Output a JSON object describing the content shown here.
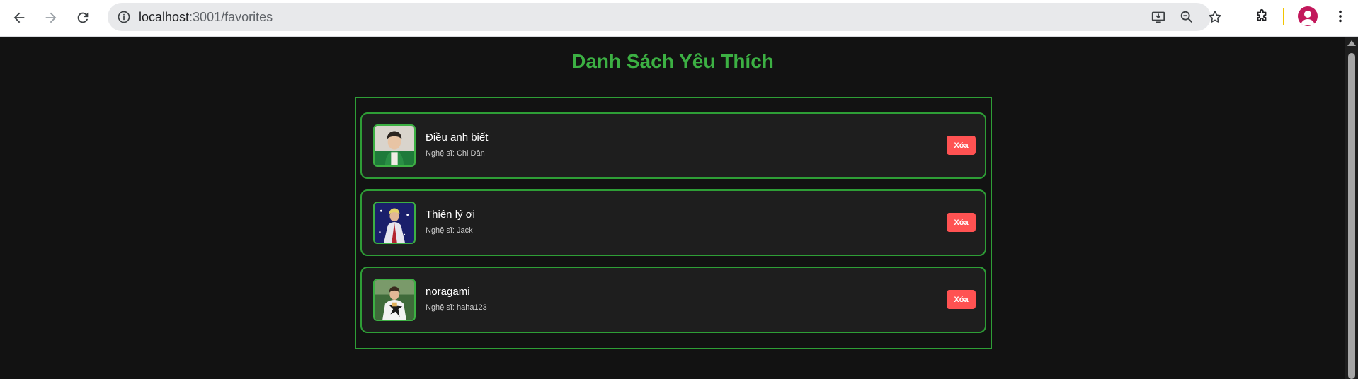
{
  "browser": {
    "url_host": "localhost",
    "url_rest": ":3001/favorites",
    "icons": {
      "back": "arrow-left-icon",
      "forward": "arrow-right-icon",
      "reload": "reload-icon",
      "info": "info-icon",
      "install": "install-app-icon",
      "zoom": "zoom-out-icon",
      "bookmark": "star-icon",
      "extensions": "puzzle-icon",
      "profile": "profile-avatar-icon",
      "menu": "kebab-menu-icon"
    }
  },
  "page": {
    "title": "Danh Sách Yêu Thích",
    "colors": {
      "accent": "#3cb043",
      "border": "#2e9e36",
      "delete": "#ff5252",
      "background": "#121212",
      "card": "#1e1e1e"
    }
  },
  "favorites": [
    {
      "title": "Điều anh biết",
      "artist_prefix": "Nghệ sĩ:",
      "artist": "Chi Dân",
      "delete_label": "Xóa"
    },
    {
      "title": "Thiên lý ơi",
      "artist_prefix": "Nghệ sĩ:",
      "artist": "Jack",
      "delete_label": "Xóa"
    },
    {
      "title": "noragami",
      "artist_prefix": "Nghệ sĩ:",
      "artist": "haha123",
      "delete_label": "Xóa"
    }
  ]
}
